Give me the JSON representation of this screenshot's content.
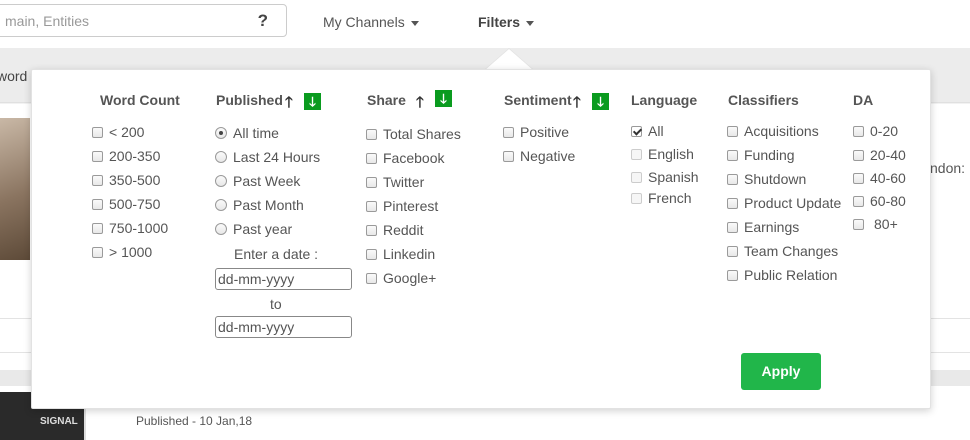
{
  "search": {
    "placeholder": "main, Entities",
    "help_glyph": "?"
  },
  "nav": {
    "my_channels": "My Channels",
    "filters": "Filters"
  },
  "background": {
    "strip_text": "word",
    "side_text": "ndon:",
    "published": "Published - 10 Jan,18",
    "thumb_text": "SIGNAL"
  },
  "filters": {
    "word_count": {
      "title": "Word Count",
      "options": [
        "< 200",
        "200-350",
        "350-500",
        "500-750",
        "750-1000",
        "> 1000"
      ]
    },
    "published": {
      "title": "Published",
      "options": [
        "All time",
        "Last 24 Hours",
        "Past Week",
        "Past Month",
        "Past year"
      ],
      "selected": "All time",
      "date_label": "Enter a date :",
      "to_label": "to",
      "date_placeholder": "dd-mm-yyyy"
    },
    "share": {
      "title": "Share",
      "options": [
        "Total Shares",
        "Facebook",
        "Twitter",
        "Pinterest",
        "Reddit",
        "Linkedin",
        "Google+"
      ]
    },
    "sentiment": {
      "title": "Sentiment",
      "options": [
        "Positive",
        "Negative"
      ]
    },
    "language": {
      "title": "Language",
      "options": [
        "All",
        "English",
        "Spanish",
        "French"
      ],
      "checked": "All"
    },
    "classifiers": {
      "title": "Classifiers",
      "options": [
        "Acquisitions",
        "Funding",
        "Shutdown",
        "Product Update",
        "Earnings",
        "Team Changes",
        "Public Relation"
      ]
    },
    "da": {
      "title": "DA",
      "options": [
        "0-20",
        "20-40",
        "40-60",
        "60-80",
        "80+"
      ]
    },
    "sort_up_glyph": "🡑",
    "sort_down_glyph": "🡓",
    "apply_label": "Apply",
    "accent_color": "#21b64a",
    "sort_color": "#0a9b1f"
  }
}
